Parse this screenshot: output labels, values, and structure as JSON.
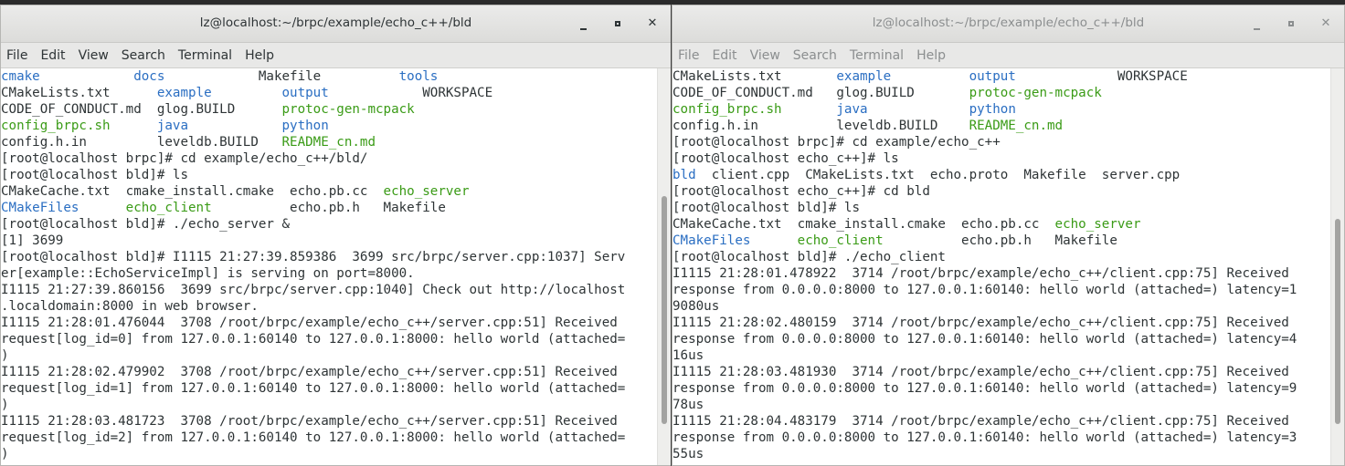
{
  "colors": {
    "dir": "#2a6ec2",
    "exe": "#3a9b16",
    "text": "#2e3436"
  },
  "windows": [
    {
      "title": "lz@localhost:~/brpc/example/echo_c++/bld",
      "menu": [
        "File",
        "Edit",
        "View",
        "Search",
        "Terminal",
        "Help"
      ],
      "lines": [
        [
          {
            "t": "cmake",
            "c": "dir"
          },
          {
            "t": "            "
          },
          {
            "t": "docs",
            "c": "dir"
          },
          {
            "t": "            Makefile          "
          },
          {
            "t": "tools",
            "c": "dir"
          }
        ],
        [
          {
            "t": "CMakeLists.txt      "
          },
          {
            "t": "example",
            "c": "dir"
          },
          {
            "t": "         "
          },
          {
            "t": "output",
            "c": "dir"
          },
          {
            "t": "            WORKSPACE"
          }
        ],
        [
          {
            "t": "CODE_OF_CONDUCT.md  glog.BUILD      "
          },
          {
            "t": "protoc-gen-mcpack",
            "c": "exe"
          }
        ],
        [
          {
            "t": "config_brpc.sh",
            "c": "exe"
          },
          {
            "t": "      "
          },
          {
            "t": "java",
            "c": "dir"
          },
          {
            "t": "            "
          },
          {
            "t": "python",
            "c": "dir"
          }
        ],
        [
          {
            "t": "config.h.in         leveldb.BUILD   "
          },
          {
            "t": "README_cn.md",
            "c": "exe"
          }
        ],
        [
          {
            "t": "[root@localhost brpc]# cd example/echo_c++/bld/"
          }
        ],
        [
          {
            "t": "[root@localhost bld]# ls"
          }
        ],
        [
          {
            "t": "CMakeCache.txt  cmake_install.cmake  echo.pb.cc  "
          },
          {
            "t": "echo_server",
            "c": "exe"
          }
        ],
        [
          {
            "t": "CMakeFiles",
            "c": "dir"
          },
          {
            "t": "      "
          },
          {
            "t": "echo_client",
            "c": "exe"
          },
          {
            "t": "          echo.pb.h   Makefile"
          }
        ],
        [
          {
            "t": "[root@localhost bld]# ./echo_server &"
          }
        ],
        [
          {
            "t": "[1] 3699"
          }
        ],
        [
          {
            "t": "[root@localhost bld]# I1115 21:27:39.859386  3699 src/brpc/server.cpp:1037] Serv"
          }
        ],
        [
          {
            "t": "er[example::EchoServiceImpl] is serving on port=8000."
          }
        ],
        [
          {
            "t": "I1115 21:27:39.860156  3699 src/brpc/server.cpp:1040] Check out http://localhost"
          }
        ],
        [
          {
            "t": ".localdomain:8000 in web browser."
          }
        ],
        [
          {
            "t": "I1115 21:28:01.476044  3708 /root/brpc/example/echo_c++/server.cpp:51] Received"
          }
        ],
        [
          {
            "t": "request[log_id=0] from 127.0.0.1:60140 to 127.0.0.1:8000: hello world (attached="
          }
        ],
        [
          {
            "t": ")"
          }
        ],
        [
          {
            "t": "I1115 21:28:02.479902  3708 /root/brpc/example/echo_c++/server.cpp:51] Received"
          }
        ],
        [
          {
            "t": "request[log_id=1] from 127.0.0.1:60140 to 127.0.0.1:8000: hello world (attached="
          }
        ],
        [
          {
            "t": ")"
          }
        ],
        [
          {
            "t": "I1115 21:28:03.481723  3708 /root/brpc/example/echo_c++/server.cpp:51] Received"
          }
        ],
        [
          {
            "t": "request[log_id=2] from 127.0.0.1:60140 to 127.0.0.1:8000: hello world (attached="
          }
        ],
        [
          {
            "t": ")"
          }
        ]
      ]
    },
    {
      "title": "lz@localhost:~/brpc/example/echo_c++/bld",
      "menu": [
        "File",
        "Edit",
        "View",
        "Search",
        "Terminal",
        "Help"
      ],
      "lines": [
        [
          {
            "t": "CMakeLists.txt       "
          },
          {
            "t": "example",
            "c": "dir"
          },
          {
            "t": "          "
          },
          {
            "t": "output",
            "c": "dir"
          },
          {
            "t": "             WORKSPACE"
          }
        ],
        [
          {
            "t": "CODE_OF_CONDUCT.md   glog.BUILD       "
          },
          {
            "t": "protoc-gen-mcpack",
            "c": "exe"
          }
        ],
        [
          {
            "t": "config_brpc.sh",
            "c": "exe"
          },
          {
            "t": "       "
          },
          {
            "t": "java",
            "c": "dir"
          },
          {
            "t": "             "
          },
          {
            "t": "python",
            "c": "dir"
          }
        ],
        [
          {
            "t": "config.h.in          leveldb.BUILD    "
          },
          {
            "t": "README_cn.md",
            "c": "exe"
          }
        ],
        [
          {
            "t": "[root@localhost brpc]# cd example/echo_c++"
          }
        ],
        [
          {
            "t": "[root@localhost echo_c++]# ls"
          }
        ],
        [
          {
            "t": "bld",
            "c": "dir"
          },
          {
            "t": "  client.cpp  CMakeLists.txt  echo.proto  Makefile  server.cpp"
          }
        ],
        [
          {
            "t": "[root@localhost echo_c++]# cd bld"
          }
        ],
        [
          {
            "t": "[root@localhost bld]# ls"
          }
        ],
        [
          {
            "t": "CMakeCache.txt  cmake_install.cmake  echo.pb.cc  "
          },
          {
            "t": "echo_server",
            "c": "exe"
          }
        ],
        [
          {
            "t": "CMakeFiles",
            "c": "dir"
          },
          {
            "t": "      "
          },
          {
            "t": "echo_client",
            "c": "exe"
          },
          {
            "t": "          echo.pb.h   Makefile"
          }
        ],
        [
          {
            "t": "[root@localhost bld]# ./echo_client"
          }
        ],
        [
          {
            "t": "I1115 21:28:01.478922  3714 /root/brpc/example/echo_c++/client.cpp:75] Received"
          }
        ],
        [
          {
            "t": "response from 0.0.0.0:8000 to 127.0.0.1:60140: hello world (attached=) latency=1"
          }
        ],
        [
          {
            "t": "9080us"
          }
        ],
        [
          {
            "t": "I1115 21:28:02.480159  3714 /root/brpc/example/echo_c++/client.cpp:75] Received"
          }
        ],
        [
          {
            "t": "response from 0.0.0.0:8000 to 127.0.0.1:60140: hello world (attached=) latency=4"
          }
        ],
        [
          {
            "t": "16us"
          }
        ],
        [
          {
            "t": "I1115 21:28:03.481930  3714 /root/brpc/example/echo_c++/client.cpp:75] Received"
          }
        ],
        [
          {
            "t": "response from 0.0.0.0:8000 to 127.0.0.1:60140: hello world (attached=) latency=9"
          }
        ],
        [
          {
            "t": "78us"
          }
        ],
        [
          {
            "t": "I1115 21:28:04.483179  3714 /root/brpc/example/echo_c++/client.cpp:75] Received"
          }
        ],
        [
          {
            "t": "response from 0.0.0.0:8000 to 127.0.0.1:60140: hello world (attached=) latency=3"
          }
        ],
        [
          {
            "t": "55us"
          }
        ]
      ]
    }
  ],
  "window_controls": {
    "minimize_icon": "minimize-icon",
    "maximize_icon": "maximize-icon",
    "close_icon": "close-icon",
    "close_glyph": "✕"
  }
}
